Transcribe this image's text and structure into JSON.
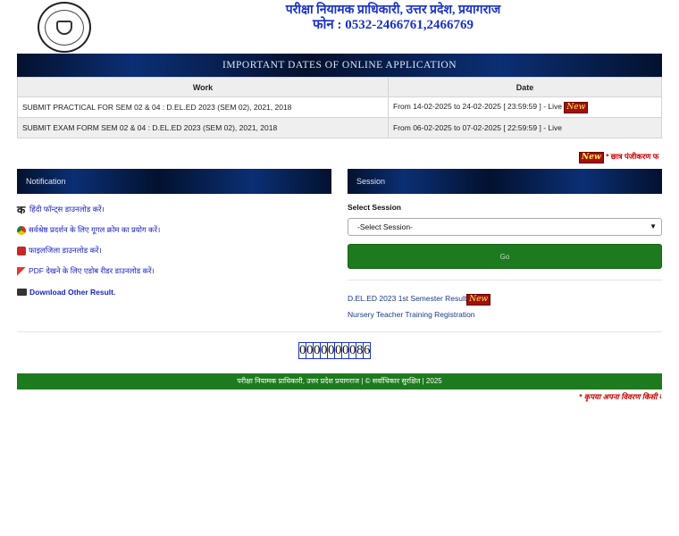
{
  "header": {
    "title": "परीक्षा नियामक प्राधिकारी, उत्तर प्रदेश, प्रयागराज",
    "phone": "फोन : 0532-2466761,2466769"
  },
  "important_dates": {
    "heading": "IMPORTANT DATES OF ONLINE APPLICATION",
    "columns": [
      "Work",
      "Date"
    ],
    "rows": [
      {
        "work": "SUBMIT PRACTICAL FOR SEM 02 & 04 : D.EL.ED 2023 (SEM 02), 2021, 2018",
        "date": "From 14-02-2025 to 24-02-2025 [ 23:59:59 ] - Live",
        "new": "New"
      },
      {
        "work": "SUBMIT EXAM FORM SEM 02 & 04 : D.EL.ED 2023 (SEM 02), 2021, 2018",
        "date": "From 06-02-2025 to 07-02-2025 [ 22:59:59 ] - Live"
      }
    ]
  },
  "marquee": {
    "new": "New",
    "text": "* छात्र पंजीकरण फ"
  },
  "notification": {
    "heading": "Notification",
    "items": [
      {
        "icon": "ka-letter-icon",
        "label": "हिंदी फॉन्ट्स डाउनलोड करें।"
      },
      {
        "icon": "chrome-icon",
        "label": "सर्वश्रेष्ठ प्रदर्शन के लिए गूगल क्रोम का प्रयोग करें।"
      },
      {
        "icon": "file-icon",
        "label": "फाइलजिला डाउनलोड करें।"
      },
      {
        "icon": "pdf-icon",
        "label": "PDF देखने के लिए एडोब रीडर डाउनलोड करें।"
      },
      {
        "icon": "graduation-cap-icon",
        "label": "Download Other Result."
      }
    ]
  },
  "session": {
    "heading": "Session",
    "label": "Select Session",
    "selected": "-Select Session-",
    "go_label": "Go",
    "links": [
      {
        "label": "D.EL.ED 2023 1st Semester Result",
        "new": "New"
      },
      {
        "label": "Nursery Teacher Training Registration"
      }
    ]
  },
  "counter": {
    "digits": "0000000086"
  },
  "footer": {
    "text": "परीक्षा नियामक प्राधिकारी, उत्तर प्रदेश प्रयागराज | © सर्वाधिकार सुरक्षित | 2025",
    "marquee": "* कृपया अपना विवरण किसी व"
  },
  "colors": {
    "link": "#1a22c8",
    "brand_blue": "#1a33c7",
    "green": "#1e7a1e",
    "red": "#cc0000"
  }
}
